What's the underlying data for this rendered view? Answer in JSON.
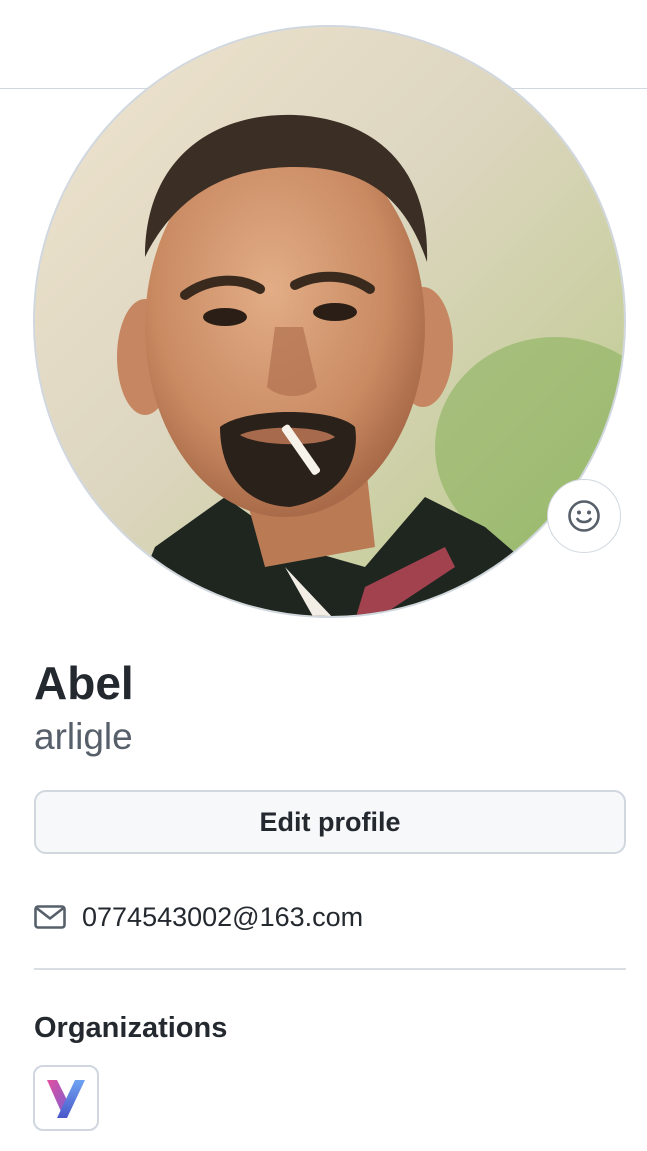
{
  "profile": {
    "full_name": "Abel",
    "username": "arligle",
    "avatar_icon": "profile-photo",
    "status_icon": "smiley-icon"
  },
  "actions": {
    "edit_profile_label": "Edit profile"
  },
  "contact": {
    "email_icon": "mail-icon",
    "email": "0774543002@163.com"
  },
  "organizations": {
    "heading": "Organizations",
    "items": [
      {
        "icon": "org-y-logo"
      }
    ]
  },
  "colors": {
    "text": "#24292f",
    "muted": "#57606a",
    "border": "#d0d7de",
    "button_bg": "#f6f8fa"
  }
}
